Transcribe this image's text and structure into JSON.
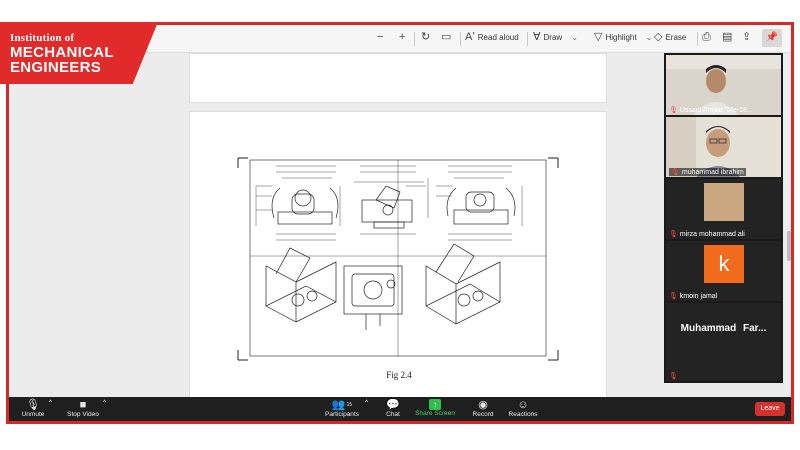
{
  "logo": {
    "line1": "Institution of",
    "line2": "MECHANICAL",
    "line3": "ENGINEERS",
    "color": "#e12a2a"
  },
  "pdf_toolbar": {
    "read_aloud": "Read aloud",
    "draw": "Draw",
    "highlight": "Highlight",
    "erase": "Erase"
  },
  "document": {
    "figure_caption": "Fig 2.4"
  },
  "participants": [
    {
      "name": "Ussaid Amjad \"Me-18...",
      "muted": true,
      "type": "video"
    },
    {
      "name": "muhammad ibrahim",
      "muted": true,
      "type": "video"
    },
    {
      "name": "mirza mohammad ali",
      "muted": true,
      "type": "photo"
    },
    {
      "name": "kmoin jamal",
      "muted": true,
      "type": "letter",
      "letter": "k",
      "avatar_color": "#f26a1c"
    },
    {
      "name": "Muhammad Far...",
      "muted": true,
      "type": "name"
    }
  ],
  "meeting_controls": {
    "unmute": "Unmute",
    "stop_video": "Stop Video",
    "participants": "Participants",
    "participant_count": "15",
    "chat": "Chat",
    "share_screen": "Share Screen",
    "record": "Record",
    "reactions": "Reactions",
    "leave": "Leave"
  },
  "colors": {
    "accent_red": "#d42a2a",
    "share_green": "#2fbf4a",
    "leave_red": "#d3312d"
  }
}
